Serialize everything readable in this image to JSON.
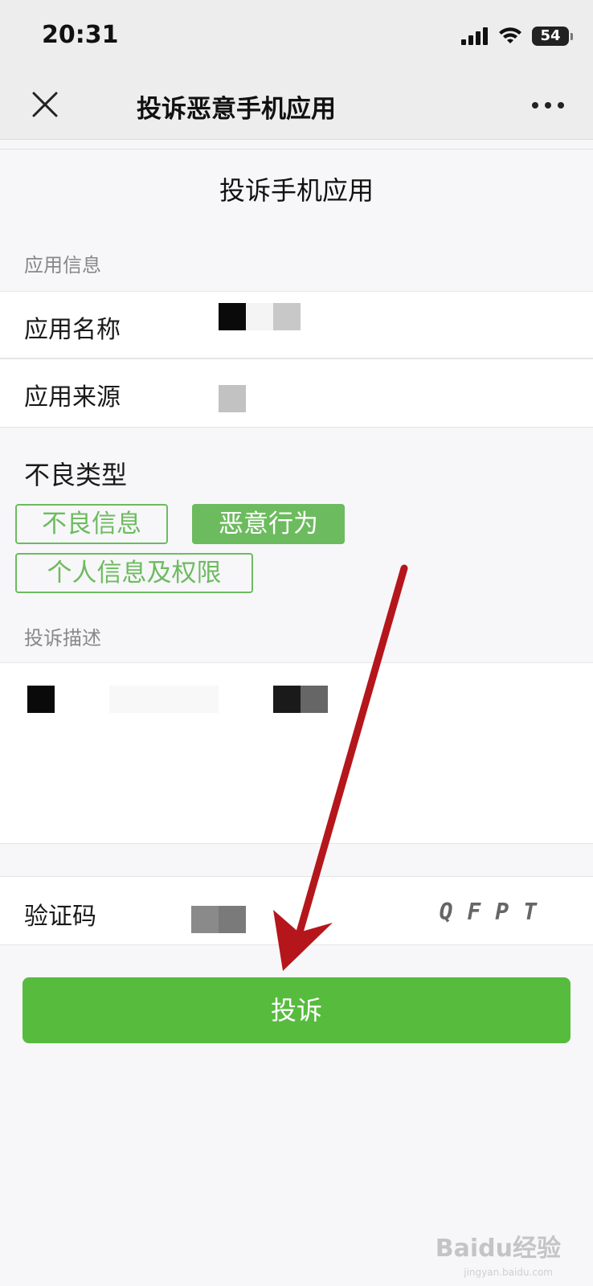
{
  "status_bar": {
    "time": "20:31",
    "battery": "54"
  },
  "nav": {
    "title": "投诉恶意手机应用"
  },
  "page": {
    "title": "投诉手机应用"
  },
  "app_info": {
    "section_label": "应用信息",
    "name_label": "应用名称",
    "source_label": "应用来源"
  },
  "bad_type": {
    "title": "不良类型",
    "options": [
      "不良信息",
      "恶意行为",
      "个人信息及权限"
    ],
    "selected": "恶意行为"
  },
  "description": {
    "section_label": "投诉描述"
  },
  "captcha": {
    "label": "验证码",
    "code": "QFPT"
  },
  "submit": {
    "label": "投诉"
  },
  "watermark": {
    "brand": "Baidu经验",
    "url": "jingyan.baidu.com"
  },
  "colors": {
    "accent": "#57bb3e",
    "tag_green": "#6dbb5f",
    "arrow_red": "#b5161b"
  }
}
